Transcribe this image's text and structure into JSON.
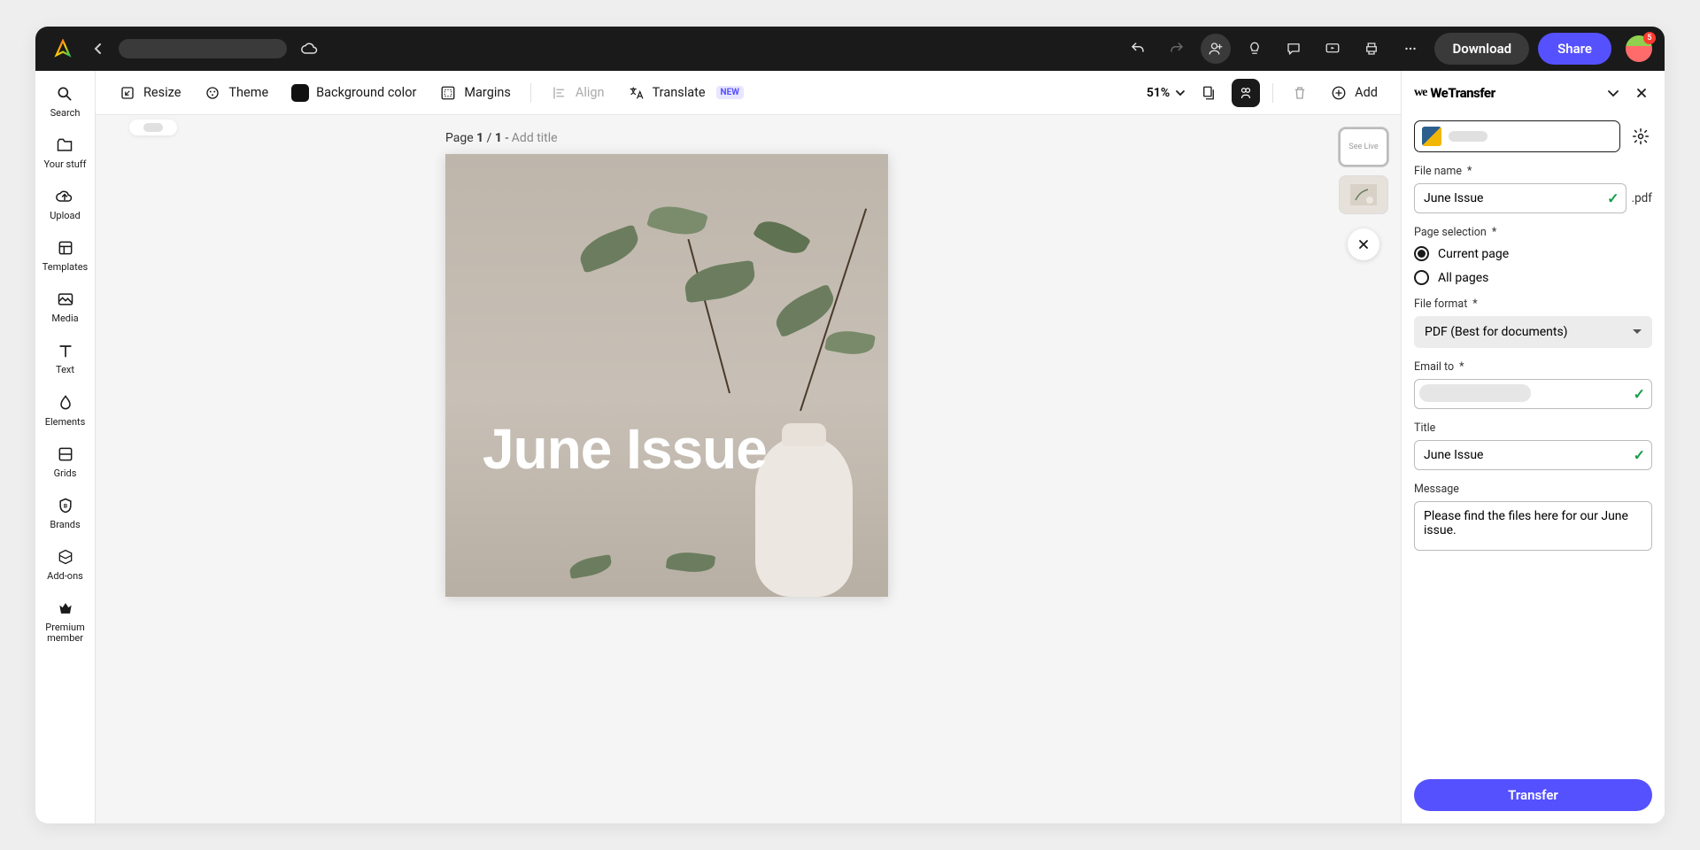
{
  "topbar": {
    "download": "Download",
    "share": "Share",
    "notification_count": "5"
  },
  "sidebar": {
    "items": [
      {
        "label": "Search"
      },
      {
        "label": "Your stuff"
      },
      {
        "label": "Upload"
      },
      {
        "label": "Templates"
      },
      {
        "label": "Media"
      },
      {
        "label": "Text"
      },
      {
        "label": "Elements"
      },
      {
        "label": "Grids"
      },
      {
        "label": "Brands"
      },
      {
        "label": "Add-ons"
      },
      {
        "label": "Premium member"
      }
    ]
  },
  "toolbar": {
    "resize": "Resize",
    "theme": "Theme",
    "bgcolor": "Background color",
    "margins": "Margins",
    "align": "Align",
    "translate": "Translate",
    "translate_badge": "NEW",
    "zoom": "51%",
    "add": "Add"
  },
  "canvas": {
    "page_prefix": "Page ",
    "page_current": "1",
    "page_sep": " / ",
    "page_total": "1",
    "page_dash": " - ",
    "add_title": "Add title",
    "title_text": "June Issue"
  },
  "wetransfer": {
    "brand": "WeTransfer",
    "filename_label": "File name",
    "filename_value": "June Issue",
    "file_ext": ".pdf",
    "page_selection_label": "Page selection",
    "radio_current": "Current page",
    "radio_all": "All pages",
    "format_label": "File format",
    "format_value": "PDF (Best for documents)",
    "email_label": "Email to",
    "title_label": "Title",
    "title_value": "June Issue",
    "message_label": "Message",
    "message_value": "Please find the files here for our June issue.",
    "transfer": "Transfer"
  }
}
